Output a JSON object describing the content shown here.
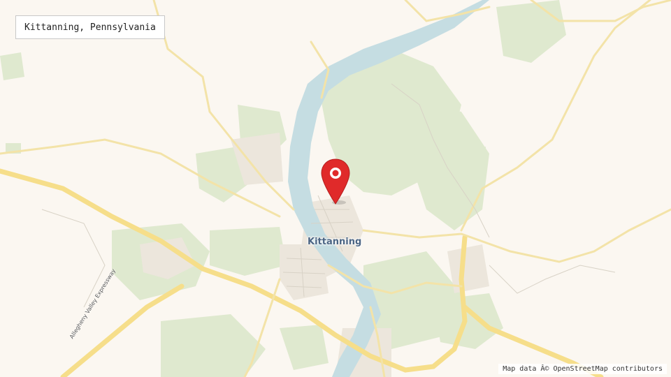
{
  "map": {
    "place_name": "Kittanning, Pennsylvania",
    "town_label": "Kittanning",
    "road_label": "Allegheny Valley Expressway",
    "attribution": "Map data Â© OpenStreetMap contributors",
    "marker_icon": "map-pin-icon"
  },
  "colors": {
    "land": "#fbf7f1",
    "water": "#c5dde2",
    "park": "#dfe9cf",
    "road_major": "#f6de8a",
    "road_minor": "#f3e3a8",
    "marker": "#e02a2a"
  }
}
